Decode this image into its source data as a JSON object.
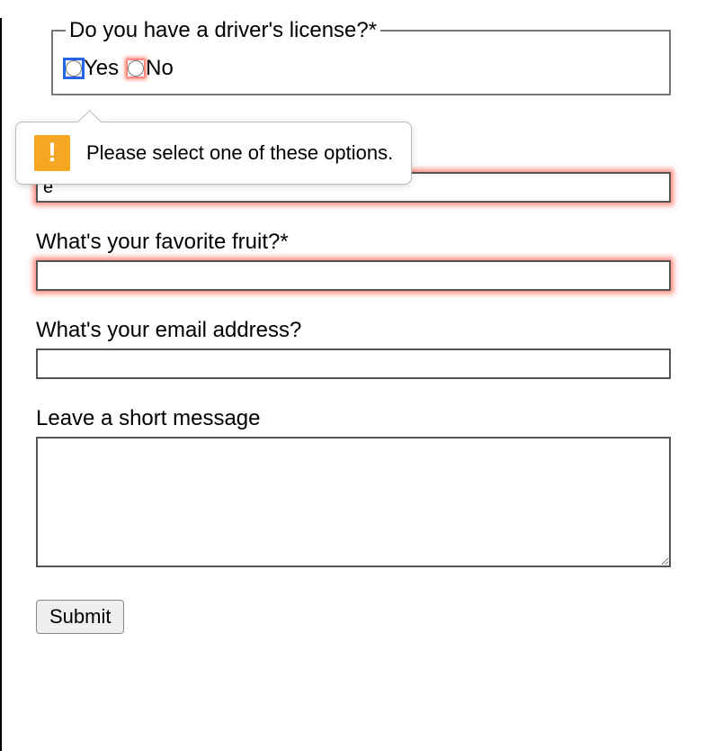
{
  "fieldset": {
    "legend": "Do you have a driver's license?*",
    "options": {
      "yes": "Yes",
      "no": "No"
    }
  },
  "tooltip": {
    "icon_glyph": "!",
    "message": "Please select one of these options."
  },
  "partial_input": {
    "value": "e"
  },
  "fruit": {
    "label": "What's your favorite fruit?*",
    "value": ""
  },
  "email": {
    "label": "What's your email address?",
    "value": ""
  },
  "message": {
    "label": "Leave a short message",
    "value": ""
  },
  "submit": {
    "label": "Submit"
  }
}
